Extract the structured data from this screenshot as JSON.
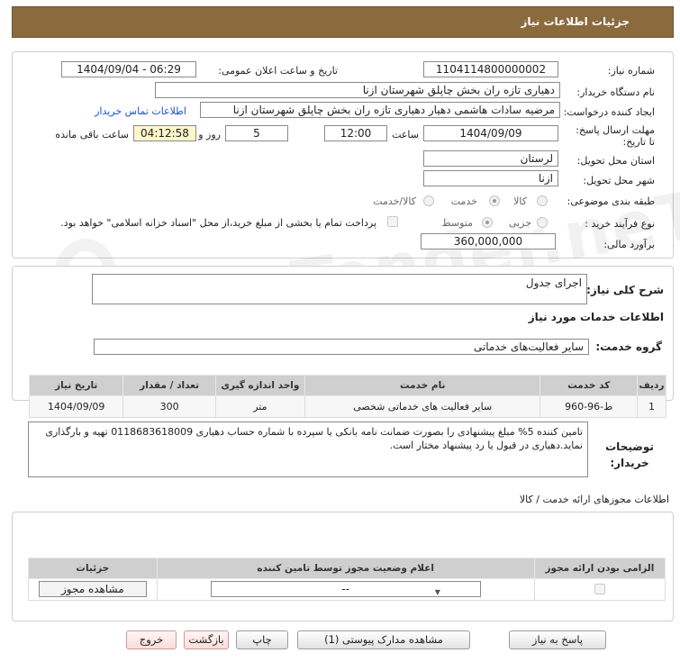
{
  "header": {
    "title": "جزئیات اطلاعات نیاز"
  },
  "watermark": "AriaTender.neT",
  "form": {
    "need_number_label": "شماره نیاز:",
    "need_number": "1104114800000002",
    "announce_label": "تاریخ و ساعت اعلان عمومی:",
    "announce_value": "1404/09/04 - 06:29",
    "buyer_org_label": "نام دستگاه خریدار:",
    "buyer_org": "دهیاری تازه ران بخش چاپلق شهرستان ازنا",
    "creator_label": "ایجاد کننده درخواست:",
    "creator": "مرضیه سادات هاشمی دهیار دهیاری تازه ران بخش چاپلق شهرستان ازنا",
    "contact_link": "اطلاعات تماس خریدار",
    "deadline_label": "مهلت ارسال پاسخ: تا تاریخ:",
    "deadline_date": "1404/09/09",
    "time_label": "ساعت",
    "deadline_time": "12:00",
    "days_value": "5",
    "days_label": "روز و",
    "remaining_time": "04:12:58",
    "remaining_label": "ساعت باقی مانده",
    "province_label": "استان محل تحویل:",
    "province": "لرستان",
    "city_label": "شهر محل تحویل:",
    "city": "ازنا",
    "category_label": "طبقه بندی موضوعی:",
    "category_options": [
      "کالا",
      "خدمت",
      "کالا/خدمت"
    ],
    "category_selected": "خدمت",
    "process_label": "نوع فرآیند خرید :",
    "process_options": [
      "جزیی",
      "متوسط"
    ],
    "process_selected": "جزیی",
    "payment_note": "پرداخت تمام یا بخشی از مبلغ خرید،از محل \"اسناد خزانه اسلامی\" خواهد بود.",
    "budget_label": "برآورد مالی:",
    "budget": "360,000,000"
  },
  "summary": {
    "label": "شرح کلی نیاز:",
    "value": "اجرای جدول"
  },
  "services": {
    "section_title": "اطلاعات خدمات مورد نیاز",
    "group_label": "گروه خدمت:",
    "group_value": "سایر فعالیت‌های خدماتی",
    "columns": [
      "ردیف",
      "کد خدمت",
      "نام خدمت",
      "واحد اندازه گیری",
      "تعداد / مقدار",
      "تاریخ نیاز"
    ],
    "rows": [
      [
        "1",
        "ط-96-960",
        "سایر فعالیت های خدماتی شخصی",
        "متر",
        "300",
        "1404/09/09"
      ]
    ]
  },
  "buyer_notes": {
    "label": "توضیحات خریدار:",
    "text": "تامین کننده 5% مبلغ پیشنهادی را بصورت ضمانت نامه بانکی  یا سپرده با شماره حساب دهیاری 0118683618009 تهیه و بارگذاری نماید.دهیاری در قبول یا رد پیشنهاد مختار است."
  },
  "permits": {
    "title": "اطلاعات مجوزهای ارائه خدمت / کالا",
    "columns": [
      "الزامی بودن ارائه مجوز",
      "اعلام وضعیت مجوز توسط تامین کننده",
      "جزئیات"
    ],
    "select_value": "--",
    "view_button": "مشاهده مجوز"
  },
  "buttons": {
    "reply": "پاسخ به نیاز",
    "attachments": "مشاهده مدارک پیوستی (1)",
    "print": "چاپ",
    "back": "بازگشت",
    "exit": "خروج"
  }
}
